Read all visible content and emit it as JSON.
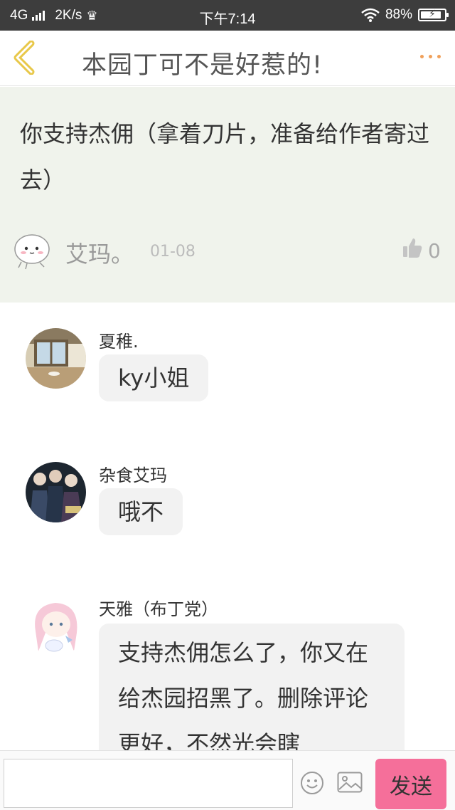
{
  "status_bar": {
    "network": "4G",
    "speed": "2K/s",
    "time": "下午7:14",
    "battery": "88%",
    "battery_level": 0.88
  },
  "header": {
    "title": "本园丁可不是好惹的!",
    "back_icon": "chevron-left-icon",
    "more_icon": "more-dots-icon",
    "accent_color": "#f0a05a"
  },
  "post": {
    "text": "你支持杰佣（拿着刀片，准备给作者寄过去）",
    "author": "艾玛。",
    "date": "01-08",
    "likes": "0",
    "background": "#f0f3ec"
  },
  "comments": [
    {
      "name": "夏稚.",
      "text": "ky小姐"
    },
    {
      "name": "杂食艾玛",
      "text": "哦不"
    },
    {
      "name": "天雅（布丁党）",
      "text": "支持杰佣怎么了，你又在给杰园招黑了。删除评论更好，不然光会瞎"
    }
  ],
  "input_bar": {
    "placeholder": "",
    "send_label": "发送",
    "send_color": "#f56f9a"
  }
}
